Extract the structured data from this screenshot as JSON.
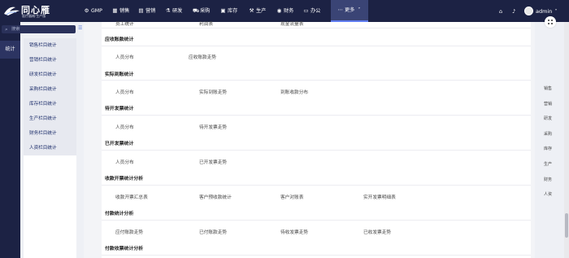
{
  "app": {
    "logo_title": "同心雁",
    "logo_subtitle": "医疗器械·生产版"
  },
  "nav": {
    "items": [
      {
        "label": "GMP",
        "icon": "gmp-icon"
      },
      {
        "label": "销售",
        "icon": "sales-icon"
      },
      {
        "label": "营销",
        "icon": "marketing-icon"
      },
      {
        "label": "研发",
        "icon": "rd-icon"
      },
      {
        "label": "采购",
        "icon": "purchase-icon"
      },
      {
        "label": "库存",
        "icon": "inventory-icon"
      },
      {
        "label": "生产",
        "icon": "production-icon"
      },
      {
        "label": "财务",
        "icon": "finance-icon"
      },
      {
        "label": "办公",
        "icon": "office-icon"
      }
    ],
    "more": "更多",
    "user": "admin"
  },
  "sidebar": {
    "active": "统计",
    "search_placeholder": "搜索",
    "items": [
      "销售栏目统计",
      "营销栏目统计",
      "研发栏目统计",
      "采购栏目统计",
      "库存栏目统计",
      "生产栏目统计",
      "财务栏目统计",
      "人资栏目统计"
    ]
  },
  "sections": {
    "top_partial": [
      "员工统计",
      "利润表",
      "现金流量表"
    ],
    "s1": {
      "title": "应收账款统计",
      "links": [
        "人员分布",
        "应收账款走势"
      ]
    },
    "s2": {
      "title": "实际到账统计",
      "links": [
        "人员分布",
        "实际到账走势",
        "到账收款分布"
      ]
    },
    "s3": {
      "title": "待开发票统计",
      "links": [
        "人员分布",
        "待开发票走势"
      ]
    },
    "s4": {
      "title": "已开发票统计",
      "links": [
        "人员分布",
        "已开发票走势"
      ]
    },
    "s5": {
      "title": "收款开票统计分析",
      "links": [
        "收款开票汇总表",
        "客户预收款统计",
        "客户对账表",
        "实开发票明细表"
      ]
    },
    "s6": {
      "title": "付款统计分析",
      "links": [
        "应付账款走势",
        "已付账款走势",
        "待收发票走势",
        "已收发票走势"
      ]
    },
    "s7": {
      "title": "付款收票统计分析"
    }
  },
  "anchors": [
    "销售",
    "营销",
    "研发",
    "采购",
    "库存",
    "生产",
    "财务",
    "人资"
  ]
}
